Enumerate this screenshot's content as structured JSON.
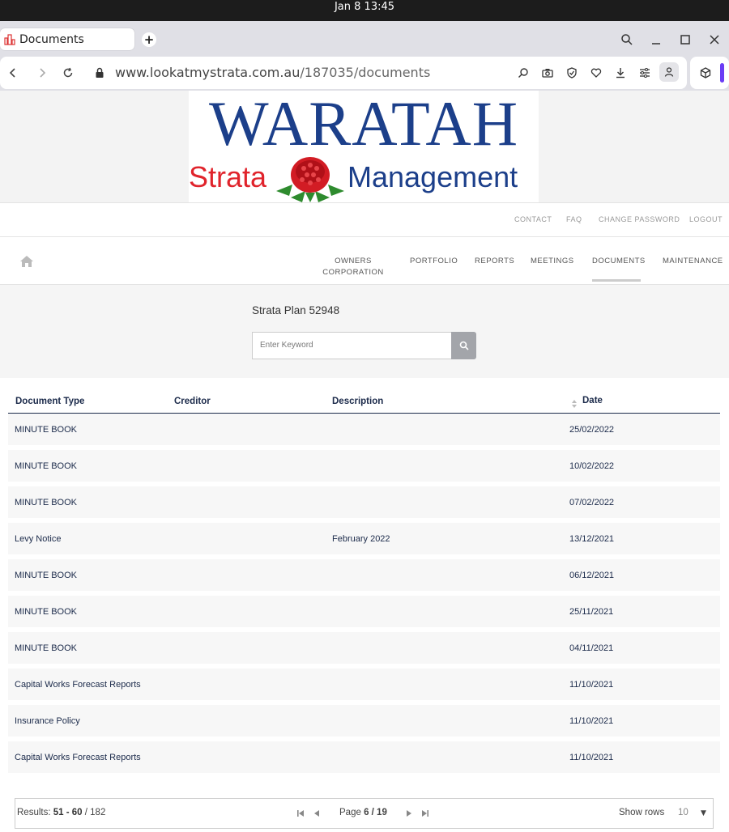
{
  "system": {
    "clock": "Jan 8  13:45"
  },
  "browser": {
    "tab_title": "Documents",
    "url_host": "www.lookatmystrata.com.au",
    "url_path": "/187035/documents"
  },
  "logo": {
    "line1": "WARATAH",
    "line2_left": "Strata",
    "line2_right": "Management"
  },
  "top_links": [
    "CONTACT",
    "FAQ",
    "CHANGE PASSWORD",
    "LOGOUT"
  ],
  "main_nav": [
    {
      "line1": "OWNERS",
      "line2": "CORPORATION"
    },
    {
      "line1": "PORTFOLIO",
      "line2": ""
    },
    {
      "line1": "REPORTS",
      "line2": ""
    },
    {
      "line1": "MEETINGS",
      "line2": ""
    },
    {
      "line1": "DOCUMENTS",
      "line2": ""
    },
    {
      "line1": "MAINTENANCE",
      "line2": ""
    }
  ],
  "active_nav": "DOCUMENTS",
  "search": {
    "plan_title": "Strata Plan 52948",
    "placeholder": "Enter Keyword"
  },
  "table": {
    "headers": {
      "type": "Document Type",
      "creditor": "Creditor",
      "description": "Description",
      "date": "Date"
    },
    "rows": [
      {
        "type": "MINUTE BOOK",
        "creditor": "",
        "description": "",
        "date": "25/02/2022"
      },
      {
        "type": "MINUTE BOOK",
        "creditor": "",
        "description": "",
        "date": "10/02/2022"
      },
      {
        "type": "MINUTE BOOK",
        "creditor": "",
        "description": "",
        "date": "07/02/2022"
      },
      {
        "type": "Levy Notice",
        "creditor": "",
        "description": "February 2022",
        "date": "13/12/2021"
      },
      {
        "type": "MINUTE BOOK",
        "creditor": "",
        "description": "",
        "date": "06/12/2021"
      },
      {
        "type": "MINUTE BOOK",
        "creditor": "",
        "description": "",
        "date": "25/11/2021"
      },
      {
        "type": "MINUTE BOOK",
        "creditor": "",
        "description": "",
        "date": "04/11/2021"
      },
      {
        "type": "Capital Works Forecast Reports",
        "creditor": "",
        "description": "",
        "date": "11/10/2021"
      },
      {
        "type": "Insurance Policy",
        "creditor": "",
        "description": "",
        "date": "11/10/2021"
      },
      {
        "type": "Capital Works Forecast Reports",
        "creditor": "",
        "description": "",
        "date": "11/10/2021"
      }
    ]
  },
  "pager": {
    "results_label": "Results:",
    "results_range": "51 - 60",
    "results_total": "/ 182",
    "page_label": "Page",
    "page_value": "6 / 19",
    "show_rows_label": "Show rows",
    "rows_per_page": "10"
  },
  "colors": {
    "brand_blue": "#1c3f8a",
    "brand_red": "#e0242c",
    "text_navy": "#1b2a4a",
    "accent_purple": "#6b3cf5"
  }
}
